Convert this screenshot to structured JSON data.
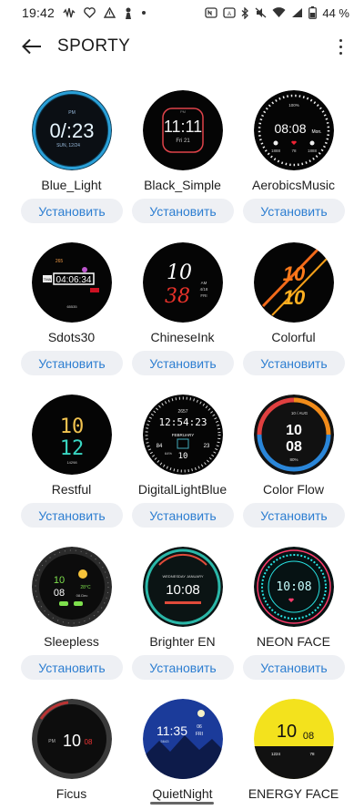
{
  "status_bar": {
    "time": "19:42",
    "battery_percent": "44 %",
    "left_icons": [
      "soundwave-icon",
      "heart-icon",
      "warning-icon",
      "figure-icon",
      "dot-icon"
    ],
    "right_icons": [
      "nfc-icon",
      "auto-brightness-icon",
      "bluetooth-icon",
      "mute-icon",
      "wifi-icon",
      "signal-icon",
      "battery-icon"
    ]
  },
  "app_bar": {
    "title": "SPORTY"
  },
  "install_label": "Установить",
  "faces": [
    {
      "name": "Blue_Light",
      "style": "blue-light"
    },
    {
      "name": "Black_Simple",
      "style": "black-simple"
    },
    {
      "name": "AerobicsMusic",
      "style": "aerobics"
    },
    {
      "name": "Sdots30",
      "style": "sdots"
    },
    {
      "name": "ChineseInk",
      "style": "chinese-ink"
    },
    {
      "name": "Colorful",
      "style": "colorful"
    },
    {
      "name": "Restful",
      "style": "restful"
    },
    {
      "name": "DigitalLightBlue",
      "style": "digital-blue"
    },
    {
      "name": "Color Flow",
      "style": "color-flow"
    },
    {
      "name": "Sleepless",
      "style": "sleepless"
    },
    {
      "name": "Brighter EN",
      "style": "brighter"
    },
    {
      "name": "NEON FACE",
      "style": "neon"
    },
    {
      "name": "Ficus",
      "style": "ficus"
    },
    {
      "name": "QuietNight",
      "style": "quiet-night"
    },
    {
      "name": "ENERGY FACE",
      "style": "energy"
    }
  ],
  "face_text": {
    "blue_light": {
      "time": "0/:23",
      "date": "SUN, 12/24",
      "pm": "PM"
    },
    "black_simple": {
      "time": "11:11",
      "date": "Fri 21",
      "pm": "PM"
    },
    "aerobics": {
      "time": "08:08",
      "day": "Mon.",
      "top": "100%",
      "vals": [
        "1888",
        "78",
        "1888"
      ]
    },
    "sdots": {
      "time": "04:06:34",
      "tag": "TMA",
      "top": "265",
      "steps": "65535"
    },
    "chinese_ink": {
      "hour": "10",
      "min": "38",
      "ampm": "AM",
      "date": "4/18",
      "day": "FRI"
    },
    "colorful": {
      "hour": "10",
      "min": "10"
    },
    "restful": {
      "hour": "10",
      "min": "12",
      "steps": "14298"
    },
    "digital_blue": {
      "time": "12:54:23",
      "top": "2657",
      "month": "FEBRUARY",
      "day": "10",
      "battery": "64%",
      "left": "84",
      "right": "23"
    },
    "color_flow": {
      "hour": "10",
      "min": "08",
      "date": "10 / AUG",
      "battery": "80%"
    },
    "sleepless": {
      "hour": "10",
      "min": "08",
      "temp": "28°C",
      "date": "08.Dec"
    },
    "brighter": {
      "time": "10:08",
      "top": "WEDNESDAY JANUARY"
    },
    "neon": {
      "time": "10:08"
    },
    "ficus": {
      "hour": "10",
      "min": "08",
      "pm": "PM"
    },
    "quiet_night": {
      "time": "11:35",
      "date": "06",
      "day": "FRI",
      "steps": "5643"
    },
    "energy": {
      "hour": "10",
      "min": "08",
      "steps": "1224",
      "heart": "78"
    }
  }
}
